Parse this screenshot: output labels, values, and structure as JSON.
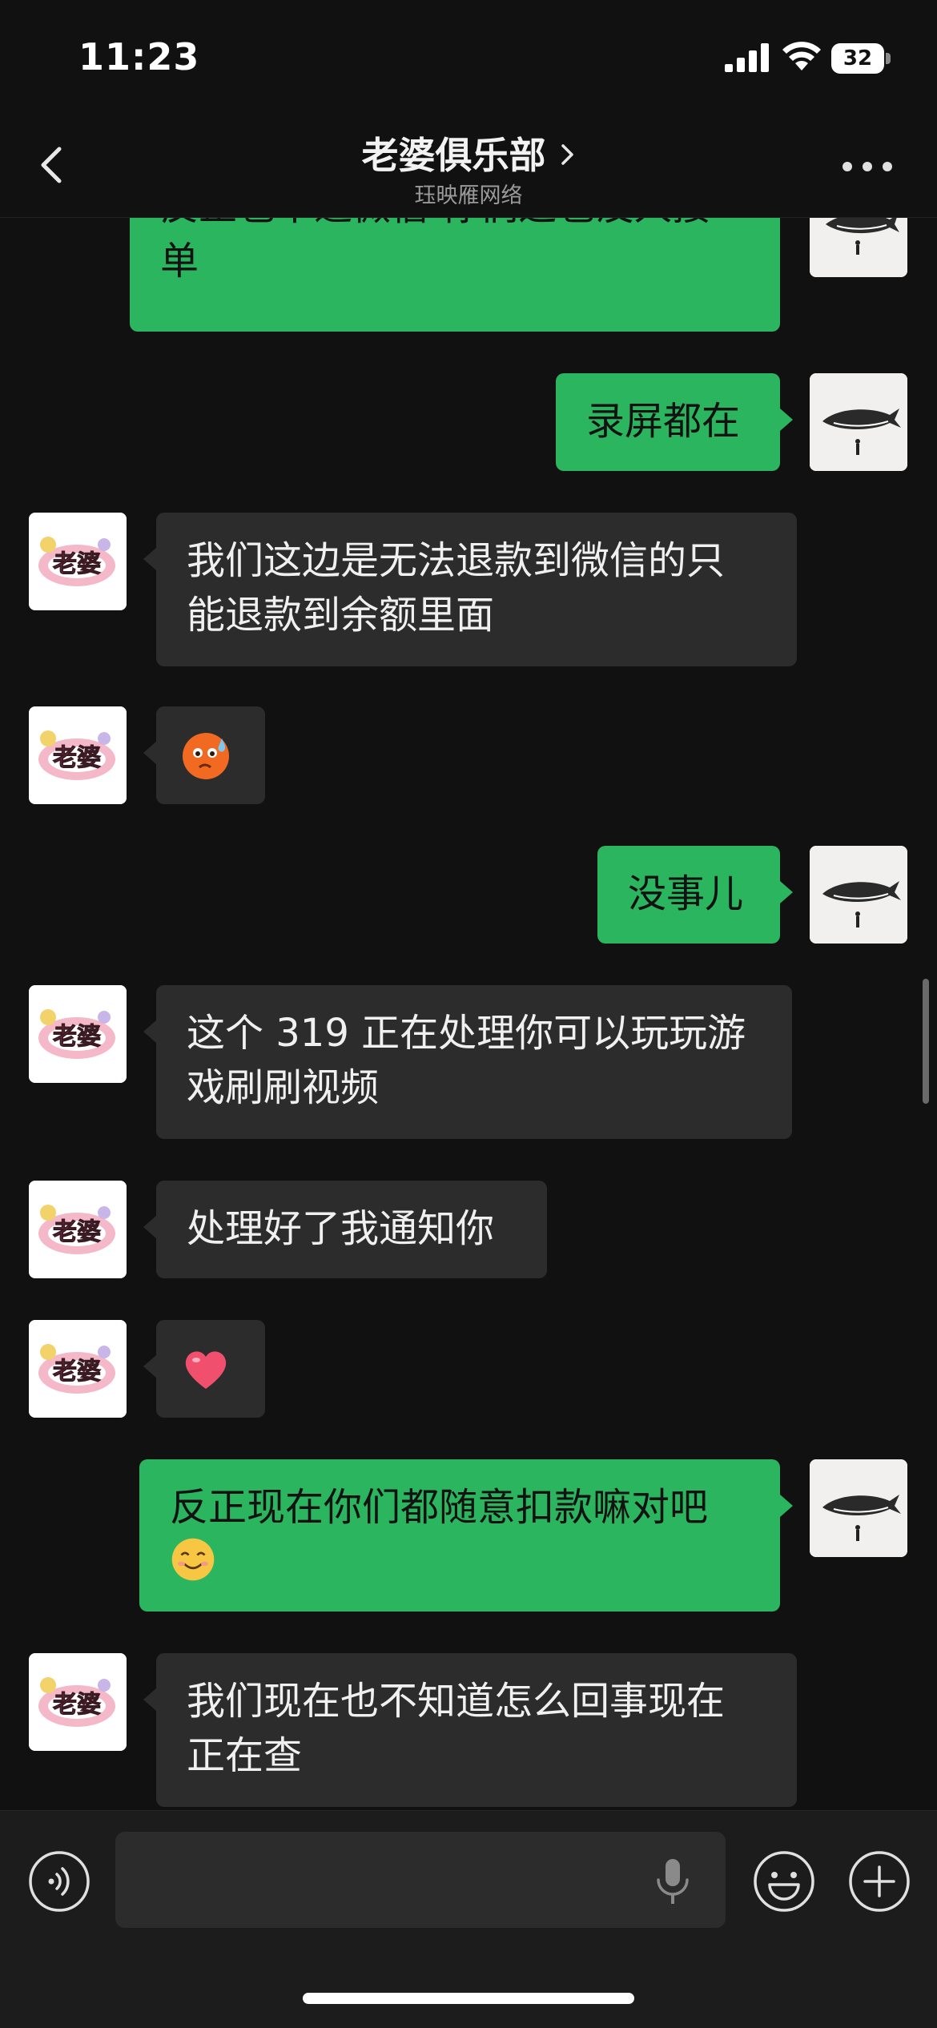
{
  "status_bar": {
    "time": "11:23",
    "battery": "32"
  },
  "nav": {
    "title": "老婆俱乐部",
    "subtitle": "珏映雁网络"
  },
  "messages": [
    {
      "sender": "me",
      "line1": "反正也不退微信 你们这也没人接",
      "line2": "单"
    },
    {
      "sender": "me",
      "line1": "录屏都在"
    },
    {
      "sender": "other",
      "line1": "我们这边是无法退款到微信的只",
      "line2": "能退款到余额里面"
    },
    {
      "sender": "other",
      "emoji": "sweat-pout-emoji"
    },
    {
      "sender": "me",
      "line1": "没事儿"
    },
    {
      "sender": "other",
      "line1": "这个 319 正在处理你可以玩玩游",
      "line2": "戏刷刷视频"
    },
    {
      "sender": "other",
      "line1": "处理好了我通知你"
    },
    {
      "sender": "other",
      "emoji": "heart-emoji"
    },
    {
      "sender": "me",
      "line1": "反正现在你们都随意扣款嘛对吧",
      "line2_emoji": "smile-emoji"
    },
    {
      "sender": "other",
      "line1": "我们现在也不知道怎么回事现在",
      "line2": "正在查"
    }
  ],
  "avatars": {
    "other_logo_text": "老婆"
  },
  "input": {
    "placeholder": ""
  },
  "colors": {
    "my_bubble": "#2bb55f",
    "other_bubble": "#2c2c2c",
    "background": "#111111"
  }
}
